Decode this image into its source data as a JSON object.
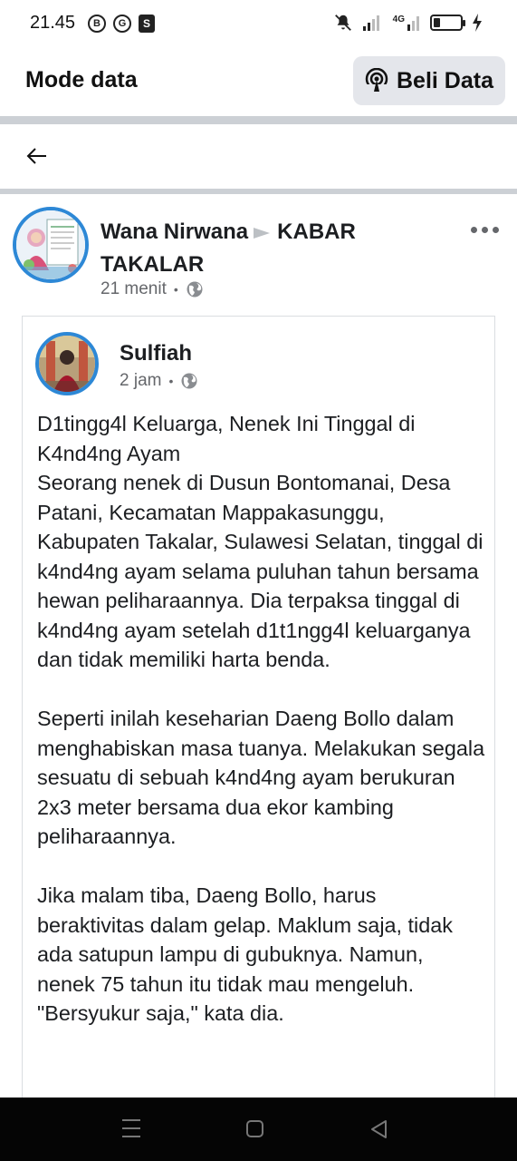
{
  "status_bar": {
    "time": "21.45",
    "left_icons": [
      "B",
      "G",
      "S"
    ],
    "network_label": "4G"
  },
  "header": {
    "title": "Mode data",
    "buy_data_label": "Beli Data"
  },
  "post": {
    "author": "Wana Nirwana",
    "group": "KABAR TAKALAR",
    "time": "21 menit",
    "shared": {
      "author": "Sulfiah",
      "time": "2 jam",
      "paragraphs": [
        "D1tingg4l Keluarga, Nenek Ini Tinggal di K4nd4ng Ayam\nSeorang nenek di Dusun Bontomanai, Desa Patani, Kecamatan Mappakasunggu, Kabupaten Takalar, Sulawesi Selatan, tinggal di k4nd4ng ayam selama puluhan tahun bersama hewan peliharaannya. Dia terpaksa tinggal di k4nd4ng ayam setelah d1t1ngg4l keluarganya dan tidak memiliki harta benda.",
        "Seperti inilah keseharian Daeng Bollo dalam menghabiskan masa tuanya. Melakukan segala sesuatu di sebuah k4nd4ng ayam berukuran 2x3 meter bersama dua ekor kambing peliharaannya.",
        "Jika malam tiba, Daeng Bollo, harus beraktivitas dalam gelap. Maklum saja, tidak ada satupun lampu di gubuknya. Namun, nenek 75 tahun itu tidak mau mengeluh. \"Bersyukur saja,\" kata dia."
      ]
    }
  },
  "colors": {
    "accent_blue": "#2d88d6",
    "secondary_text": "#65676b",
    "divider": "#ccd0d5",
    "button_bg": "#e4e6eb"
  }
}
